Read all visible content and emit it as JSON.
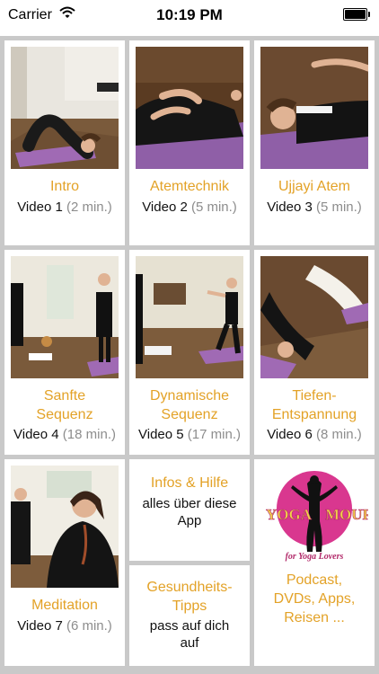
{
  "status_bar": {
    "carrier": "Carrier",
    "time": "10:19 PM"
  },
  "tiles": [
    {
      "title": "Intro",
      "video": "Video 1",
      "duration": "(2 min.)"
    },
    {
      "title": "Atemtechnik",
      "video": "Video 2",
      "duration": "(5 min.)"
    },
    {
      "title": "Ujjayi Atem",
      "video": "Video 3",
      "duration": "(5 min.)"
    },
    {
      "title_line1": "Sanfte",
      "title_line2": "Sequenz",
      "video": "Video 4",
      "duration": "(18 min.)"
    },
    {
      "title_line1": "Dynamische",
      "title_line2": "Sequenz",
      "video": "Video 5",
      "duration": "(17 min.)"
    },
    {
      "title_line1": "Tiefen-",
      "title_line2": "Entspannung",
      "video": "Video 6",
      "duration": "(8 min.)"
    },
    {
      "title": "Meditation",
      "video": "Video 7",
      "duration": "(6 min.)"
    }
  ],
  "info": {
    "title": "Infos & Hilfe",
    "line1": "alles über diese",
    "line2": "App"
  },
  "health": {
    "title_line1": "Gesundheits-",
    "title_line2": "Tipps",
    "line1": "pass auf dich",
    "line2": "auf"
  },
  "promo": {
    "logo_text_left": "YOGA",
    "logo_text_right": "MOUR",
    "logo_tagline": "for Yoga Lovers",
    "line1": "Podcast,",
    "line2": "DVDs, Apps,",
    "line3": "Reisen ..."
  },
  "colors": {
    "accent": "#e3a227",
    "duration_gray": "#8d8d8d",
    "background": "#c9c9c9",
    "logo_pink": "#d9378f"
  }
}
